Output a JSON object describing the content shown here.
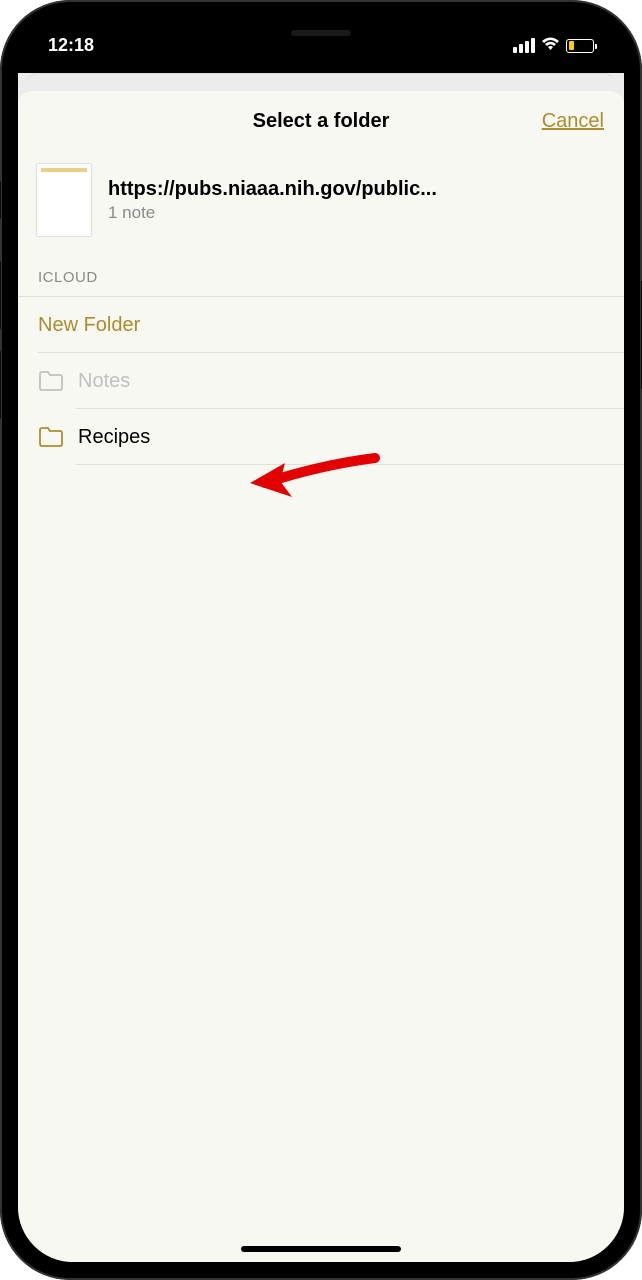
{
  "status_bar": {
    "time": "12:18"
  },
  "sheet": {
    "title": "Select a folder",
    "cancel_label": "Cancel"
  },
  "note": {
    "title": "https://pubs.niaaa.nih.gov/public...",
    "count": "1 note"
  },
  "section": {
    "header": "ICLOUD"
  },
  "folders": {
    "new_folder_label": "New Folder",
    "items": [
      {
        "label": "Notes",
        "disabled": true
      },
      {
        "label": "Recipes",
        "disabled": false
      }
    ]
  }
}
